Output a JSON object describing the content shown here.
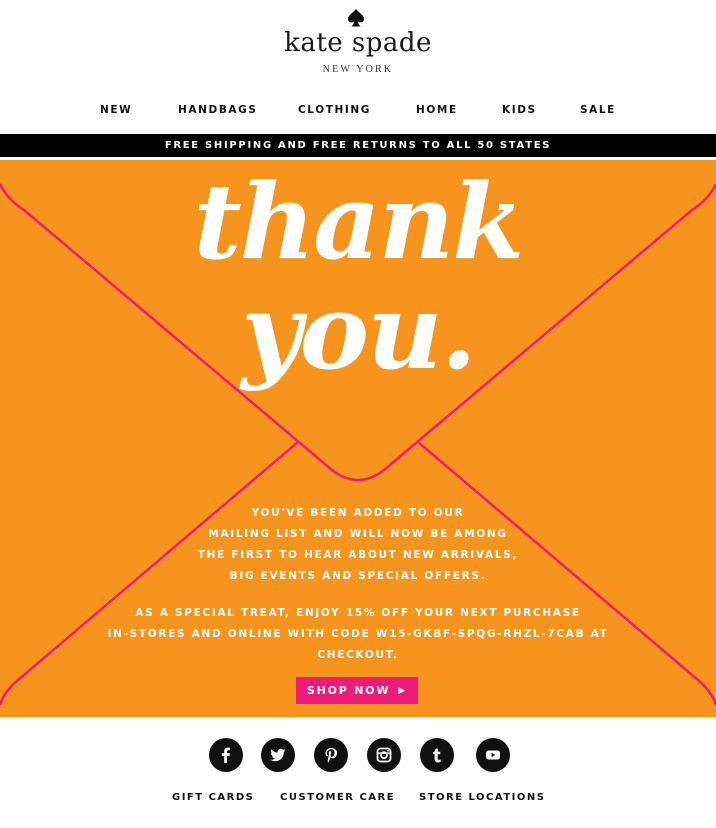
{
  "brand": {
    "name": "kate spade",
    "subtitle": "NEW YORK",
    "logo_icon": "spade-icon"
  },
  "nav": {
    "items": [
      {
        "label": "NEW"
      },
      {
        "label": "HANDBAGS"
      },
      {
        "label": "CLOTHING"
      },
      {
        "label": "HOME"
      },
      {
        "label": "KIDS"
      },
      {
        "label": "SALE"
      }
    ]
  },
  "banner": {
    "text": "FREE SHIPPING AND FREE RETURNS TO ALL 50 STATES"
  },
  "hero": {
    "headline_line1": "thank",
    "headline_line2": "you.",
    "message_lines": [
      "YOU'VE BEEN ADDED TO OUR",
      "MAILING LIST AND WILL NOW BE AMONG",
      "THE FIRST TO HEAR ABOUT NEW ARRIVALS,",
      "BIG EVENTS AND SPECIAL OFFERS."
    ],
    "offer_lines": [
      "AS A SPECIAL TREAT, ENJOY 15% OFF YOUR NEXT PURCHASE",
      "IN-STORES AND ONLINE WITH CODE W15-GKBF-SPQG-RHZL-7CAB AT",
      "CHECKOUT."
    ],
    "cta_label": "SHOP NOW",
    "cta_arrow": "▶"
  },
  "social": {
    "icons": [
      "facebook-icon",
      "twitter-icon",
      "pinterest-icon",
      "instagram-icon",
      "tumblr-icon",
      "youtube-icon"
    ]
  },
  "footer": {
    "links": [
      {
        "label": "GIFT CARDS"
      },
      {
        "label": "CUSTOMER CARE"
      },
      {
        "label": "STORE LOCATIONS"
      }
    ]
  },
  "colors": {
    "hero_bg": "#f7941d",
    "accent_pink": "#ec1c78",
    "banner_bg": "#000000",
    "text_dark": "#111111"
  }
}
